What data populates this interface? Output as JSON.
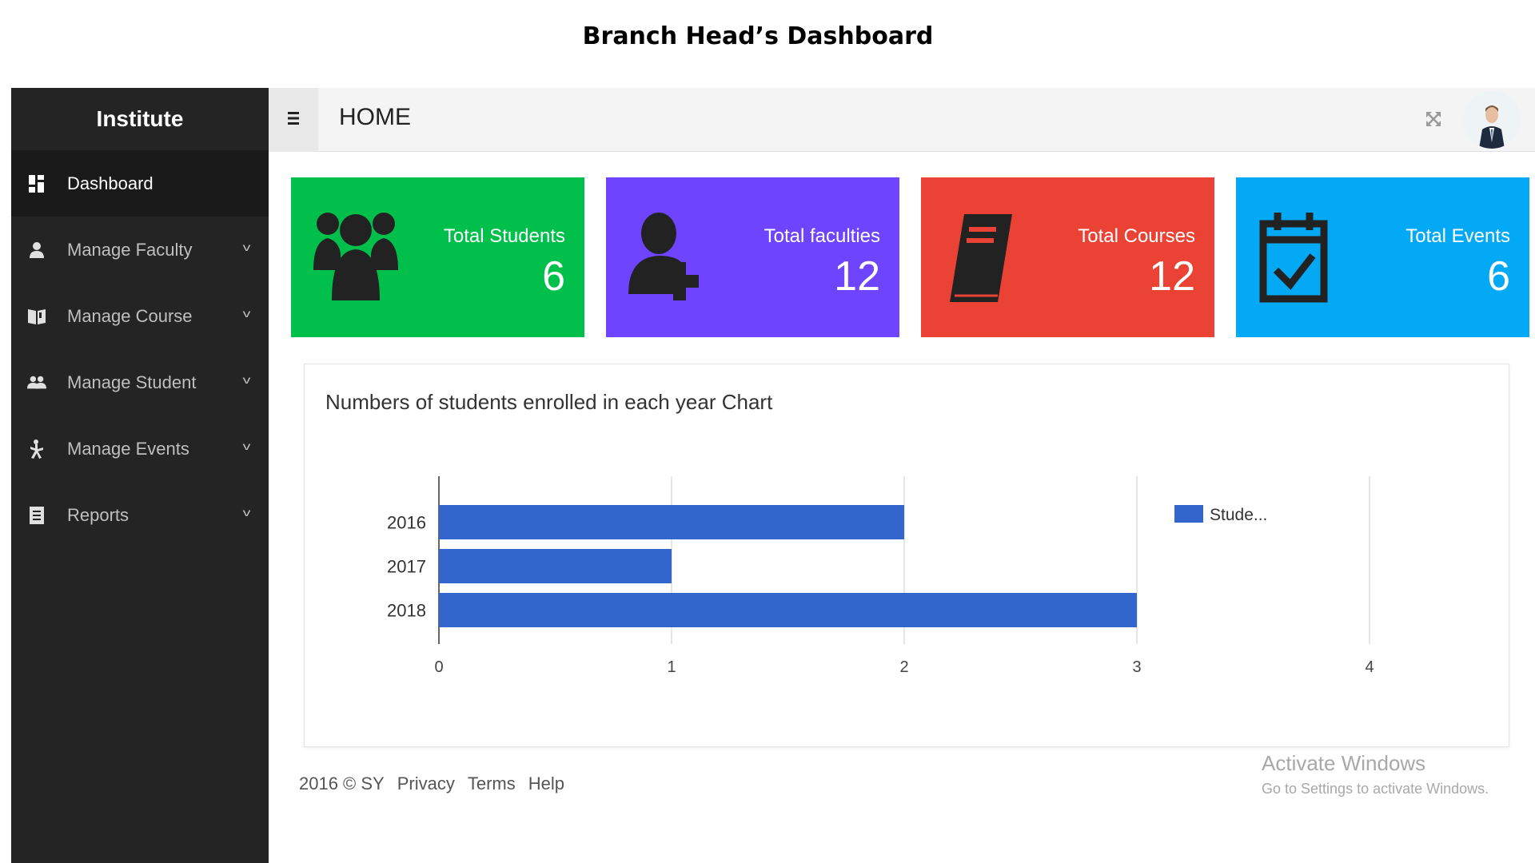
{
  "caption": "Branch Head’s Dashboard",
  "sidebar": {
    "brand": "Institute",
    "items": [
      {
        "label": "Dashboard",
        "icon": "dashboard-icon"
      },
      {
        "label": "Manage Faculty",
        "icon": "person-icon"
      },
      {
        "label": "Manage Course",
        "icon": "book-icon"
      },
      {
        "label": "Manage Student",
        "icon": "people-icon"
      },
      {
        "label": "Manage Events",
        "icon": "events-icon"
      },
      {
        "label": "Reports",
        "icon": "report-icon"
      }
    ]
  },
  "header": {
    "title": "HOME"
  },
  "cards": [
    {
      "label": "Total Students",
      "value": "6",
      "color": "#00c04b",
      "icon": "users-group-icon"
    },
    {
      "label": "Total faculties",
      "value": "12",
      "color": "#6e44ff",
      "icon": "user-plus-icon"
    },
    {
      "label": "Total Courses",
      "value": "12",
      "color": "#ea4335",
      "icon": "book-icon"
    },
    {
      "label": "Total Events",
      "value": "6",
      "color": "#03a9f4",
      "icon": "calendar-check-icon"
    }
  ],
  "chart_data": {
    "type": "bar",
    "orientation": "horizontal",
    "title": "Numbers of students enrolled in each year Chart",
    "categories": [
      "2016",
      "2017",
      "2018"
    ],
    "series": [
      {
        "name": "Stude...",
        "values": [
          2,
          1,
          3
        ],
        "color": "#3366cc"
      }
    ],
    "xlim": [
      0,
      4
    ],
    "xticks": [
      0,
      1,
      2,
      3,
      4
    ],
    "grid": true,
    "legend": "top-right"
  },
  "footer": {
    "copyright": "2016 © SY",
    "links": [
      "Privacy",
      "Terms",
      "Help"
    ]
  },
  "watermark": {
    "line1": "Activate Windows",
    "line2": "Go to Settings to activate Windows."
  }
}
